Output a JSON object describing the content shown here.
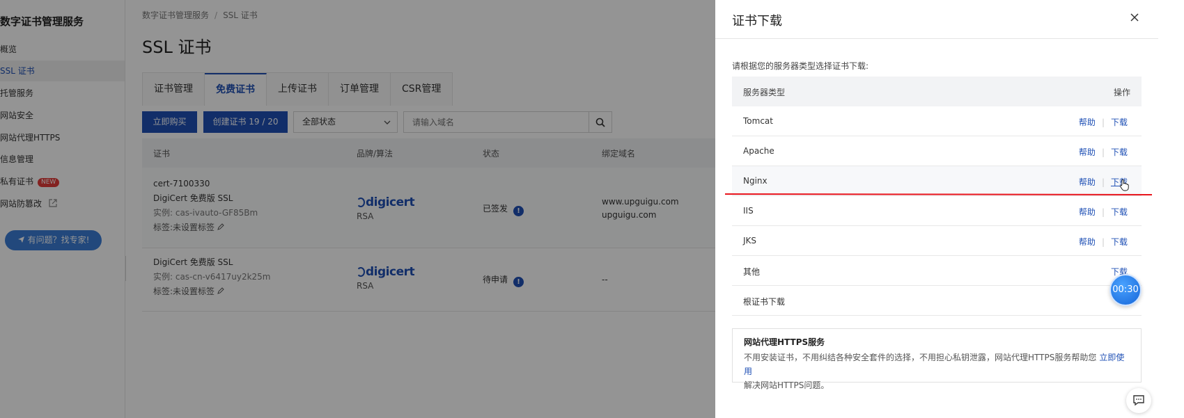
{
  "sidebar": {
    "title": "数字证书管理服务",
    "items": [
      {
        "label": "概览"
      },
      {
        "label": "SSL 证书"
      },
      {
        "label": "托管服务"
      },
      {
        "label": "网站安全"
      },
      {
        "label": "网站代理HTTPS"
      },
      {
        "label": "信息管理"
      },
      {
        "label": "私有证书",
        "badge": "NEW"
      },
      {
        "label": "网站防篡改"
      }
    ],
    "help_button": "有问题？找专家!"
  },
  "main": {
    "breadcrumb": [
      "数字证书管理服务",
      "SSL 证书"
    ],
    "page_title": "SSL 证书",
    "tabs": [
      "证书管理",
      "免费证书",
      "上传证书",
      "订单管理",
      "CSR管理"
    ],
    "toolbar": {
      "buy_label": "立即购买",
      "create_label": "创建证书 19 / 20",
      "status_select": "全部状态",
      "search_placeholder": "请输入域名"
    },
    "table": {
      "headers": [
        "证书",
        "品牌/算法",
        "状态",
        "绑定域名"
      ],
      "rows": [
        {
          "cert_id": "cert-7100330",
          "product": "DigiCert 免费版 SSL",
          "instance": "实例: cas-ivauto-GF85Bm",
          "tag": "标签:未设置标签",
          "brand": "digicert",
          "algo": "RSA",
          "status": "已签发",
          "domains": [
            "www.upguigu.com",
            "upguigu.com"
          ]
        },
        {
          "cert_id": "",
          "product": "DigiCert 免费版 SSL",
          "instance": "实例: cas-cn-v6417uy2k25m",
          "tag": "标签:未设置标签",
          "brand": "digicert",
          "algo": "RSA",
          "status": "待申请",
          "domains": [
            "--"
          ]
        }
      ]
    }
  },
  "drawer": {
    "title": "证书下载",
    "description": "请根据您的服务器类型选择证书下载:",
    "header_server": "服务器类型",
    "header_action": "操作",
    "help_label": "帮助",
    "download_label": "下载",
    "servers": [
      {
        "name": "Tomcat",
        "help": true
      },
      {
        "name": "Apache",
        "help": true
      },
      {
        "name": "Nginx",
        "help": true
      },
      {
        "name": "IIS",
        "help": true
      },
      {
        "name": "JKS",
        "help": true
      },
      {
        "name": "其他",
        "help": false
      },
      {
        "name": "根证书下载",
        "help": false
      }
    ],
    "promo": {
      "title": "网站代理HTTPS服务",
      "text_1": "不用安装证书，不用纠结各种安全套件的选择，不用担心私钥泄露，网站代理HTTPS服务帮助您",
      "link": "立即使用",
      "text_2": "解决网站HTTPS问题。"
    },
    "timer": "00:30"
  },
  "colors": {
    "primary": "#1f50b5",
    "badge": "#e23c39",
    "annotation_line": "#e8141c"
  }
}
